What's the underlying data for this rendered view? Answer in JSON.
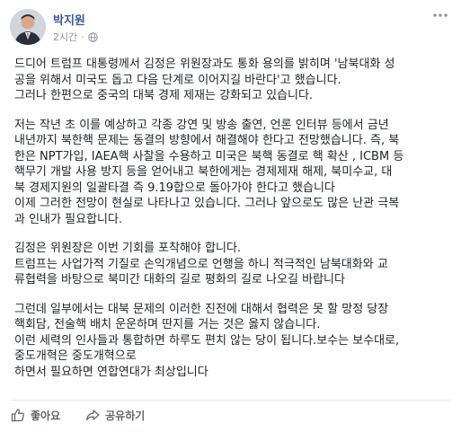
{
  "post": {
    "author": "박지원",
    "time": "2시간",
    "paragraphs": [
      "드디어 트럼프 대통령께서 김정은 위원장과도 통화 용의를 밝히며 '남북대화 성\n공을 위해서 미국도 돕고 다음 단계로 이어지길 바란다'고 했습니다.\n그러나 한편으로 중국의 대북 경제 제재는 강화되고 있습니다.",
      "저는 작년 초 이를 예상하고 각종 강연 및 방송 출연, 언론 인터뷰 등에서 금년\n내년까지 북한핵 문제는 동결의 방향에서 해결해야 한다고 전망했습니다. 즉, 북\n한은 NPT가입, IAEA핵 사찰을 수용하고 미국은 북핵 동결로 핵 확산 , ICBM 등\n핵무기 개발 사용 방지 등을 얻어내고 북한에게는 경제제재 해제, 북미수교, 대\n북 경제지원의 일괄타결 즉 9.19합으로 돌아가야 한다고 했습니다\n이제 그러한 전망이 현실로 나타나고 있습니다. 그러나 앞으로도 많은 난관 극복\n과 인내가 필요합니다.",
      "김정은 위원장은 이번 기회를 포착해야 합니다.\n트럼프는 사업가적 기질로 손익개념으로 언행을 하니 적극적인 남북대화와 교\n류협력을 바탕으로 북미간 대화의 길로 평화의 길로 나오길 바랍니다",
      "그런데 일부에서는 대북 문제의 이러한 진전에 대해서 협력은 못 할 망정 당장\n핵회담, 전술핵 배치 운운하며 딴지를 거는 것은 옳지 않습니다.\n이런 세력의 인사들과 통합하면 하루도 편치 않는 당이 됩니다.보수는 보수대로,\n중도개혁은 중도개혁으로\n하면서 필요하면 연합연대가 최상입니다"
    ]
  },
  "actions": {
    "like_label": "좋아요",
    "share_label": "공유하기"
  },
  "icons": {
    "privacy": "globe-icon",
    "more": "more-options-icon",
    "like": "thumbs-up-icon",
    "share": "share-arrow-icon"
  },
  "colors": {
    "author_link": "#385898",
    "text": "#1d2129",
    "meta": "#90949c",
    "action": "#606770"
  }
}
